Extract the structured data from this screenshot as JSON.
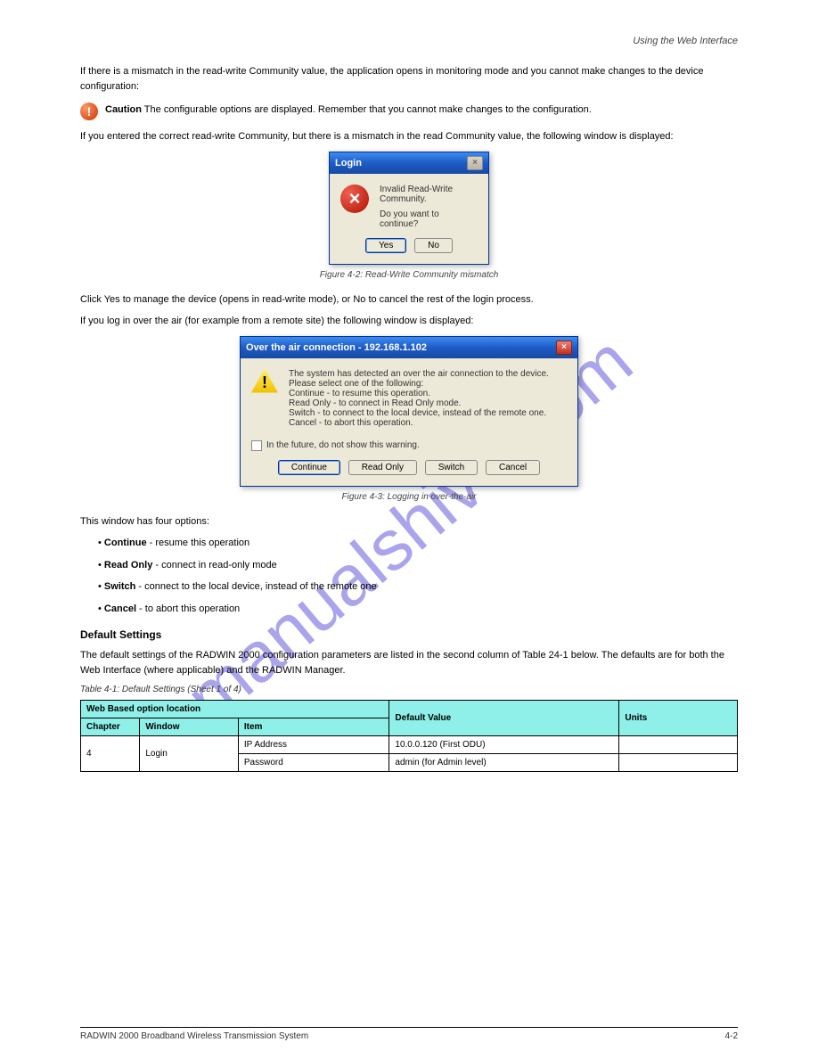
{
  "header": {
    "line": "Using the Web Interface"
  },
  "paragraphs": {
    "p1": "If there is a mismatch in the read-write Community value, the application opens in monitoring mode and you cannot make changes to the device configuration:",
    "caution_label": "Caution",
    "caution_text": "   The configurable options are displayed. Remember that you cannot make changes to the configuration.",
    "p2": "If you entered the correct read-write Community, but there is a mismatch in the read Community value, the following window is displayed:",
    "afterLogin": "Click Yes to manage the device (opens in read-write mode), or No to cancel the rest of the login process.",
    "p3": "If you log in over the air (for example from a remote site) the following window is displayed:",
    "afterOta_lead": "This window has four options:",
    "optContinue": " - resume this operation",
    "optReadOnly": " - connect in read-only mode",
    "optSwitch": " - connect to the local device, instead of the remote one",
    "optCancel": " - to abort this operation",
    "h3": "Default Settings",
    "p4": "The default settings of the RADWIN 2000 configuration parameters are listed in the second column of Table 24-1 below. The defaults are for both the Web Interface (where applicable) and the RADWIN Manager."
  },
  "figLabels": {
    "fig1": "Figure 4-2: Read-Write Community mismatch",
    "fig2": "Figure 4-3: Logging in over-the-air"
  },
  "loginDialog": {
    "title": "Login",
    "msg1": "Invalid Read-Write Community.",
    "msg2": "Do you want to continue?",
    "yes": "Yes",
    "no": "No"
  },
  "otaDialog": {
    "title": "Over the air connection - 192.168.1.102",
    "l1": "The system has detected an over the air connection to the device.",
    "l2": "Please select one of the following:",
    "l3": "Continue - to resume this operation.",
    "l4": "Read Only - to connect in Read Only mode.",
    "l5": "Switch - to connect to the local device, instead of the remote one.",
    "l6": "Cancel - to abort this operation.",
    "check": "In the future, do not show this warning.",
    "btnContinue": "Continue",
    "btnReadOnly": "Read Only",
    "btnSwitch": "Switch",
    "btnCancel": "Cancel"
  },
  "options": {
    "continue": "Continue",
    "readonly": "Read Only",
    "switch": "Switch",
    "cancel": "Cancel"
  },
  "table": {
    "caption": "Table 4-1: Default Settings (Sheet 1 of 4)",
    "headers": {
      "lead": "Web Based option location",
      "default": "Default Value",
      "units": "Units",
      "chapter": "Chapter",
      "window": "Window",
      "item": "Item"
    },
    "rows": [
      {
        "chapter": "4",
        "window": "Login",
        "item": "IP Address",
        "default": "10.0.0.120 (First ODU)",
        "units": ""
      },
      {
        "chapter": "",
        "window": "",
        "item": "Password",
        "default": "admin (for Admin level)",
        "units": ""
      }
    ]
  },
  "footer": {
    "left": "RADWIN 2000 Broadband Wireless Transmission System",
    "right": "4-2"
  }
}
